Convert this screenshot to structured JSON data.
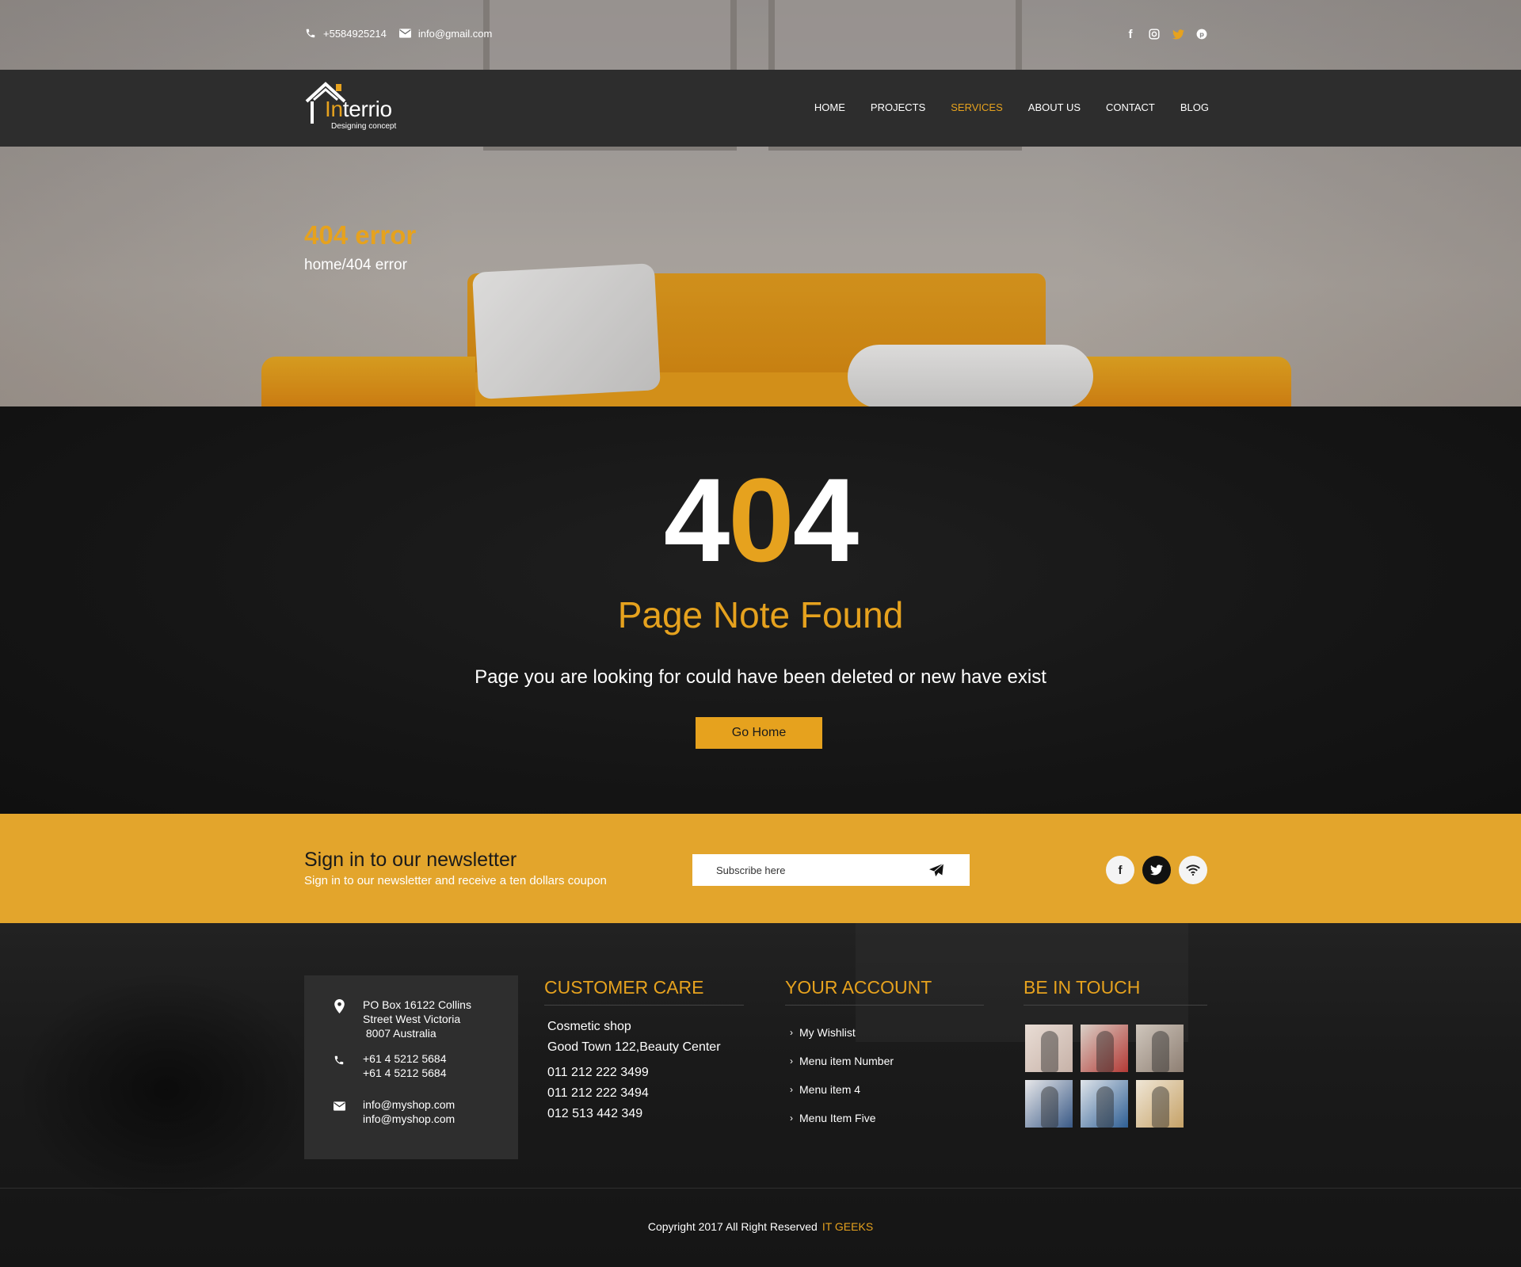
{
  "topbar": {
    "phone": "+5584925214",
    "email": "info@gmail.com",
    "social_icons": [
      "facebook-icon",
      "instagram-icon",
      "twitter-icon",
      "pinterest-icon"
    ]
  },
  "brand": {
    "name_prefix": "In",
    "name_rest": "terrio",
    "tagline": "Designing concept"
  },
  "nav": {
    "items": [
      {
        "label": "HOME",
        "active": false
      },
      {
        "label": "PROJECTS",
        "active": false
      },
      {
        "label": "SERVICES",
        "active": true
      },
      {
        "label": "ABOUT US",
        "active": false
      },
      {
        "label": "CONTACT",
        "active": false
      },
      {
        "label": "BLOG",
        "active": false
      }
    ]
  },
  "banner": {
    "title": "404 error",
    "breadcrumb": "home/404 error"
  },
  "error": {
    "code_left": "4",
    "code_mid": "0",
    "code_right": "4",
    "heading": "Page Note Found",
    "message": "Page you are looking for could have been deleted or new have exist",
    "button": "Go Home"
  },
  "newsletter": {
    "title": "Sign in to our newsletter",
    "subtitle": "Sign in to our newsletter and receive a ten  dollars coupon",
    "placeholder": "Subscribe here",
    "social_icons": [
      "facebook-icon",
      "twitter-icon",
      "wifi-icon"
    ]
  },
  "footer": {
    "address_lines": [
      "PO Box 16122 Collins",
      "Street West Victoria",
      " 8007 Australia"
    ],
    "phone_lines": [
      "+61 4 5212 5684",
      "+61 4 5212 5684"
    ],
    "email_lines": [
      "info@myshop.com",
      "info@myshop.com"
    ],
    "customer_care": {
      "title": "CUSTOMER CARE",
      "text_lines": [
        "Cosmetic shop",
        "Good Town 122,Beauty Center"
      ],
      "phones": [
        "011 212 222 3499",
        "011 212 222 3494",
        "012 513 442 349"
      ]
    },
    "account": {
      "title": "YOUR ACCOUNT",
      "links": [
        "My Wishlist",
        "Menu item Number",
        "Menu item 4",
        "Menu Item Five"
      ]
    },
    "touch": {
      "title": "BE IN TOUCH"
    },
    "copyright": "Copyright 2017  All Right Reserved",
    "copyright_brand": "IT GEEKS"
  },
  "colors": {
    "accent": "#e6a21e",
    "nav_bg": "#2d2d2d",
    "dark_bg": "#141414",
    "newsletter_bg": "#e3a52c"
  }
}
